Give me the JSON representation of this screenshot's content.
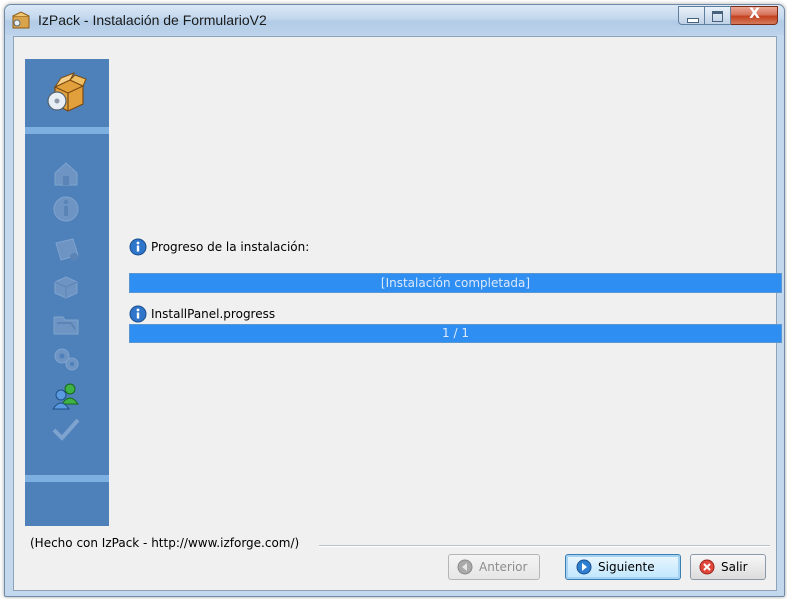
{
  "window": {
    "title": "IzPack - Instalación de FormularioV2",
    "close_glyph": "X",
    "controls": [
      "minimize-icon",
      "maximize-icon",
      "close-icon"
    ]
  },
  "sidebar": {
    "header_icon": "package-box-icon",
    "step_icons": [
      "home-icon",
      "info-icon",
      "license-icon",
      "packs-icon",
      "target-folder-icon",
      "gears-icon",
      "users-icon",
      "checkmark-icon"
    ],
    "active_step_icon": "users-icon"
  },
  "main": {
    "progress_label": "Progreso de la instalación:",
    "overall_progress": {
      "text": "[Instalación completada]",
      "fraction": 1.0
    },
    "pack_label": "InstallPanel.progress",
    "pack_progress": {
      "text": "1 / 1",
      "fraction": 1.0
    }
  },
  "footer": {
    "credit": "(Hecho con IzPack - http://www.izforge.com/)"
  },
  "buttons": {
    "previous": {
      "label": "Anterior",
      "enabled": false,
      "icon": "arrow-left-icon"
    },
    "next": {
      "label": "Siguiente",
      "enabled": true,
      "icon": "arrow-right-icon"
    },
    "quit": {
      "label": "Salir",
      "enabled": true,
      "icon": "stop-x-icon"
    }
  },
  "colors": {
    "sidebar": "#4e80ba",
    "progress_bar": "#2f8ef2",
    "client_bg": "#f0f0f0"
  }
}
